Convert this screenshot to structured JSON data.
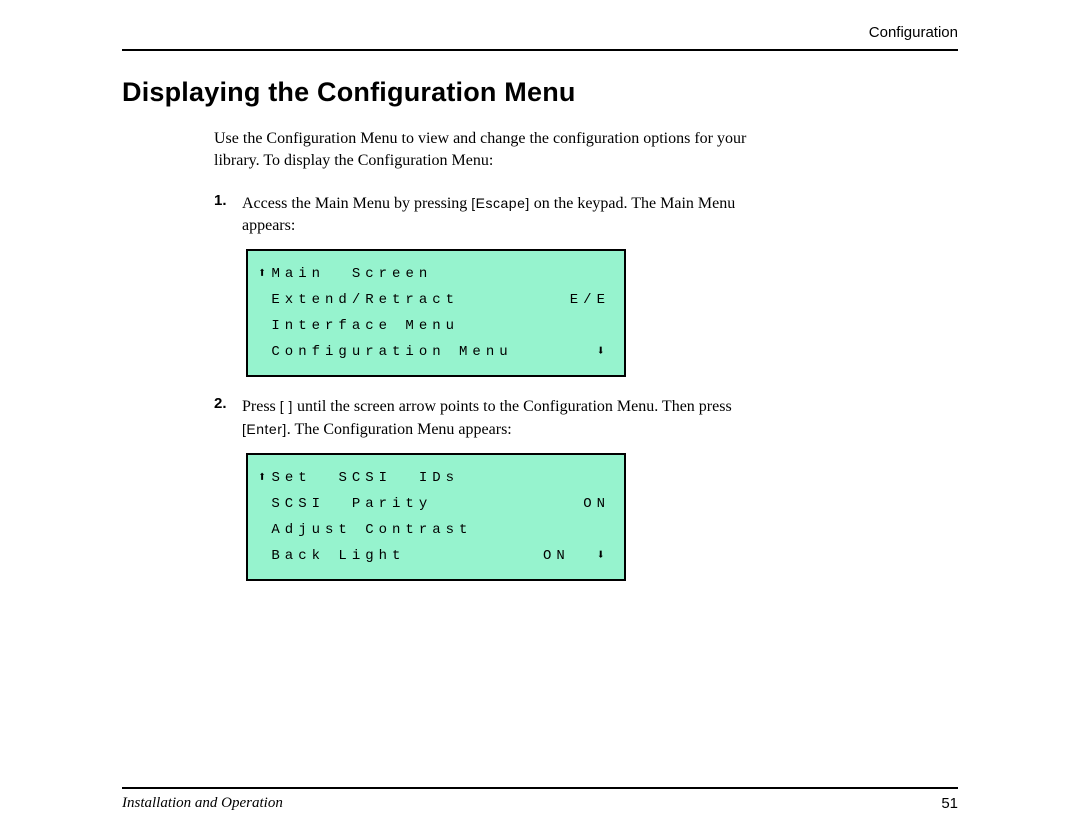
{
  "header": {
    "running": "Configuration"
  },
  "title": "Displaying the Configuration Menu",
  "intro": "Use the Configuration Menu to view and change the configuration options for your library. To display the Configuration Menu:",
  "steps": [
    {
      "num": "1.",
      "before": "Access the Main Menu by pressing ",
      "key": "[Escape]",
      "after": " on the keypad. The Main Menu appears:"
    },
    {
      "num": "2.",
      "before": "Press ",
      "key1": "[ ]",
      "mid": " until the screen arrow points to the Configuration Menu. Then press ",
      "key2": "[Enter]",
      "after": ". The Configuration Menu appears:"
    }
  ],
  "lcd1": {
    "rows": [
      {
        "prefix": "",
        "left": "Main  Screen",
        "right": ""
      },
      {
        "prefix": " ",
        "left": "Extend/Retract",
        "right": "E/E"
      },
      {
        "prefix": " ",
        "left": "Interface Menu",
        "right": ""
      },
      {
        "prefix": " ",
        "left": "Configuration Menu",
        "right": ""
      }
    ]
  },
  "lcd2": {
    "rows": [
      {
        "prefix": "",
        "left": "Set  SCSI  IDs",
        "right": ""
      },
      {
        "prefix": " ",
        "left": "SCSI  Parity",
        "right": "ON"
      },
      {
        "prefix": " ",
        "left": "Adjust Contrast",
        "right": ""
      },
      {
        "prefix": " ",
        "left": "Back Light",
        "right": "ON  "
      }
    ]
  },
  "footer": {
    "left": "Installation and Operation",
    "page": "51"
  }
}
